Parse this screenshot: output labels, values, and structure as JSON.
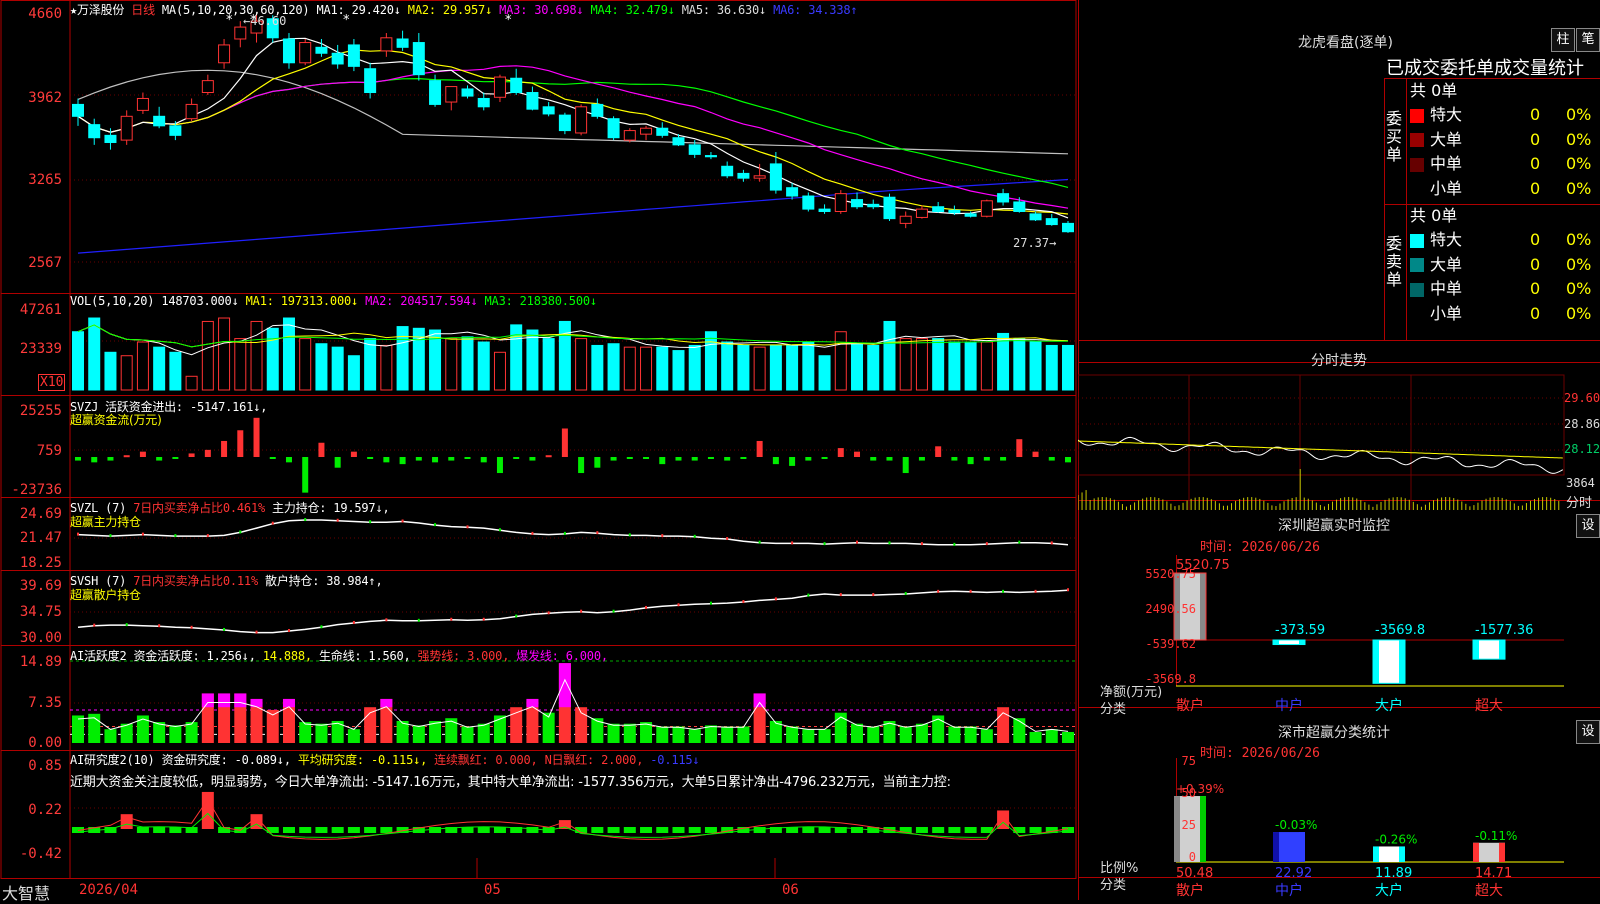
{
  "colors": {
    "up": "#ff3333",
    "down": "#00ffff",
    "ma5": "#ffffff",
    "ma10": "#ffff00",
    "ma20": "#ff00ff",
    "ma30": "#00ff00",
    "ma60": "#c0c0c0",
    "ma120": "#2020ff",
    "grid": "#b00000",
    "buyRed": "#ff2020"
  },
  "stock": {
    "name": "★万泽股份",
    "period": "日线",
    "ma_label": "MA(5,10,20,30,60,120)",
    "ma1": "MA1: 29.420↓",
    "ma2": "MA2: 29.957↓",
    "ma3": "MA3: 30.698↓",
    "ma4": "MA4: 32.479↓",
    "ma5": "MA5: 36.630↓",
    "ma6": "MA6: 34.338↑",
    "high_mark": "46.60",
    "low_mark": "27.37"
  },
  "price_axis": {
    "t1": "4660",
    "t2": "3962",
    "t3": "3265",
    "t4": "2567"
  },
  "vol": {
    "label": "VOL(5,10,20)",
    "v": "148703.000↓",
    "ma1": "MA1: 197313.000↓",
    "ma2": "MA2: 204517.594↓",
    "ma3": "MA3: 218380.500↓",
    "t1": "47261",
    "t2": "23339",
    "x10": "X10"
  },
  "svzj": {
    "label": "SVZJ  活跃资金进出: -5147.161↓,",
    "sub": "超赢资金流(万元)",
    "t1": "25255",
    "t2": "759",
    "t3": "-23736"
  },
  "svzl": {
    "label": "SVZL (7)",
    "red": "7日内买卖净占比0.461%",
    "val": "主力持仓: 19.597↓,",
    "sub": "超赢主力持仓",
    "t1": "24.69",
    "t2": "21.47",
    "t3": "18.25"
  },
  "svsh": {
    "label": "SVSH (7)",
    "red": "7日内买卖净占比0.11%",
    "val": "散户持仓: 38.984↑,",
    "sub": "超赢散户持仓",
    "t1": "39.69",
    "t2": "34.75",
    "t3": "30.00"
  },
  "ai2": {
    "label": "AI活跃度2 资金活跃度: 1.256↓,",
    "yellow": "14.888,",
    "life": "生命线: 1.560,",
    "strong": "强势线: 3.000,",
    "burst": "爆发线: 6.000,",
    "t1": "14.89",
    "t2": "7.35",
    "t3": "0.00"
  },
  "ai_research": {
    "label": "AI研究度2(10) 资金研究度: -0.089↓,",
    "avg": "平均研究度: -0.115↓,",
    "red": "连续飘红: 0.000,",
    "n": "N日飘红: 2.000,",
    "last": "-0.115↓",
    "comment": "近期大资金关注度较低，明显弱势，今日大单净流出: -5147.16万元，其中特大单净流出: -1577.356万元，大单5日累计净出-4796.232万元，当前主力控:",
    "t1": "0.85",
    "t2": "0.22",
    "t3": "-0.42"
  },
  "date_axis": {
    "start": "2026/04",
    "m5": "05",
    "m6": "06",
    "brand": "大智慧"
  },
  "lhb": {
    "title": "龙虎看盘(逐单)",
    "btn1": "柱",
    "btn2": "笔",
    "heading": "已成交委托单成交量统计",
    "buy_side": "委买单",
    "sell_side": "委卖单",
    "buy_total": "共 0单",
    "sell_total": "共 0单",
    "rows": [
      {
        "name": "特大",
        "v": "0",
        "p": "0%"
      },
      {
        "name": "大单",
        "v": "0",
        "p": "0%"
      },
      {
        "name": "中单",
        "v": "0",
        "p": "0%"
      },
      {
        "name": "小单",
        "v": "0",
        "p": "0%"
      }
    ]
  },
  "minute": {
    "title": "分时走势",
    "t1": "29.60",
    "t2": "28.86",
    "t3": "28.12",
    "t4": "3864",
    "t5": "分时"
  },
  "sz_monitor": {
    "title": "深圳超赢实时监控",
    "btn": "设",
    "time": "时间: 2026/06/26",
    "ylabel": "净额(万元)",
    "xlabel": "分类",
    "t1": "5520.75",
    "t2": "2490.56",
    "t3": "-539.62",
    "t4": "-3569.8",
    "categories": [
      "散户",
      "中户",
      "大户",
      "超大"
    ],
    "values": [
      5520.75,
      -373.59,
      -3569.8,
      -1577.36
    ],
    "labels": [
      "5520.75",
      "-373.59",
      "-3569.8",
      "-1577.36"
    ]
  },
  "sz_class": {
    "title": "深市超赢分类统计",
    "btn": "设",
    "time": "时间: 2026/06/26",
    "ylabel": "比例%",
    "xlabel": "分类",
    "t1": "75",
    "t2": "50",
    "t3": "25",
    "t4": "0",
    "categories": [
      "散户",
      "中户",
      "大户",
      "超大"
    ],
    "values": [
      50.48,
      22.92,
      11.89,
      14.71
    ],
    "labels": [
      "50.48",
      "22.92",
      "11.89",
      "14.71"
    ],
    "changes": [
      "+0.39%",
      "-0.03%",
      "-0.26%",
      "-0.11%"
    ]
  },
  "chart_data": [
    {
      "type": "candlestick",
      "title": "万泽股份 日线",
      "ylim": [
        2400,
        4700
      ],
      "high": "46.60",
      "low": "27.37",
      "ohlc": [
        [
          3900,
          3950,
          3720,
          3800
        ],
        [
          3730,
          3780,
          3560,
          3620
        ],
        [
          3640,
          3700,
          3520,
          3580
        ],
        [
          3600,
          3850,
          3560,
          3800
        ],
        [
          3850,
          4000,
          3820,
          3950
        ],
        [
          3800,
          3880,
          3700,
          3720
        ],
        [
          3720,
          3760,
          3600,
          3640
        ],
        [
          3780,
          3950,
          3760,
          3900
        ],
        [
          4000,
          4150,
          3980,
          4100
        ],
        [
          4250,
          4450,
          4200,
          4400
        ],
        [
          4450,
          4600,
          4380,
          4550
        ],
        [
          4500,
          4660,
          4420,
          4600
        ],
        [
          4620,
          4650,
          4420,
          4460
        ],
        [
          4450,
          4500,
          4200,
          4250
        ],
        [
          4250,
          4450,
          4230,
          4420
        ],
        [
          4380,
          4450,
          4300,
          4330
        ],
        [
          4330,
          4400,
          4200,
          4240
        ],
        [
          4400,
          4450,
          4180,
          4220
        ],
        [
          4200,
          4250,
          3950,
          4000
        ],
        [
          4350,
          4500,
          4300,
          4460
        ],
        [
          4450,
          4520,
          4350,
          4380
        ],
        [
          4420,
          4500,
          4100,
          4150
        ],
        [
          4100,
          4150,
          3880,
          3900
        ],
        [
          3920,
          4050,
          3850,
          4050
        ],
        [
          4030,
          4060,
          3950,
          3970
        ],
        [
          3950,
          4000,
          3850,
          3880
        ],
        [
          3960,
          4150,
          3920,
          4130
        ],
        [
          4120,
          4200,
          3980,
          4000
        ],
        [
          4000,
          4050,
          3850,
          3860
        ],
        [
          3880,
          3920,
          3800,
          3820
        ],
        [
          3810,
          3830,
          3650,
          3680
        ],
        [
          3660,
          3900,
          3640,
          3880
        ],
        [
          3900,
          3950,
          3780,
          3800
        ],
        [
          3780,
          3800,
          3600,
          3620
        ],
        [
          3600,
          3700,
          3580,
          3680
        ],
        [
          3650,
          3720,
          3600,
          3700
        ],
        [
          3700,
          3750,
          3620,
          3640
        ],
        [
          3620,
          3650,
          3550,
          3560
        ],
        [
          3560,
          3600,
          3450,
          3480
        ],
        [
          3470,
          3500,
          3440,
          3460
        ],
        [
          3380,
          3420,
          3280,
          3300
        ],
        [
          3320,
          3350,
          3250,
          3280
        ],
        [
          3280,
          3400,
          3250,
          3300
        ],
        [
          3400,
          3500,
          3150,
          3180
        ],
        [
          3200,
          3240,
          3100,
          3130
        ],
        [
          3130,
          3160,
          3000,
          3020
        ],
        [
          3020,
          3060,
          2980,
          3000
        ],
        [
          3000,
          3180,
          2980,
          3150
        ],
        [
          3100,
          3160,
          3020,
          3040
        ],
        [
          3060,
          3100,
          3020,
          3040
        ],
        [
          3120,
          3150,
          2920,
          2940
        ],
        [
          2900,
          3000,
          2860,
          2960
        ],
        [
          2950,
          3050,
          2940,
          3020
        ],
        [
          3040,
          3080,
          2990,
          3000
        ],
        [
          3010,
          3050,
          2970,
          2990
        ],
        [
          2980,
          3000,
          2950,
          2960
        ],
        [
          2960,
          3100,
          2950,
          3090
        ],
        [
          3150,
          3190,
          3050,
          3080
        ],
        [
          3080,
          3120,
          2990,
          3000
        ],
        [
          2980,
          3000,
          2920,
          2930
        ],
        [
          2940,
          2980,
          2880,
          2890
        ],
        [
          2900,
          2920,
          2820,
          2830
        ]
      ]
    },
    {
      "type": "bar",
      "title": "VOL(5,10,20)",
      "values": [
        34000,
        42000,
        22000,
        20000,
        28000,
        25000,
        22000,
        8000,
        40000,
        42000,
        30000,
        40000,
        36000,
        42000,
        30000,
        27000,
        25000,
        20000,
        30000,
        26000,
        37000,
        36000,
        35000,
        30000,
        31000,
        28000,
        22000,
        38000,
        35000,
        30000,
        40000,
        30000,
        26000,
        27000,
        25000,
        25000,
        25000,
        23000,
        26000,
        34000,
        28000,
        26000,
        25000,
        26000,
        26000,
        28000,
        20000,
        34000,
        27000,
        26000,
        40000,
        30000,
        30000,
        30000,
        28000,
        28000,
        28000,
        33000,
        30000,
        28000,
        26000,
        26000
      ]
    },
    {
      "type": "bar",
      "title": "SVZJ 活跃资金进出",
      "values": [
        -2000,
        -3000,
        -2000,
        1000,
        3000,
        -2000,
        -1000,
        2000,
        4000,
        9000,
        15000,
        22000,
        -1000,
        -3000,
        -20000,
        8000,
        -6000,
        3000,
        -1000,
        -3000,
        -4000,
        -2000,
        -3000,
        -2000,
        -1000,
        -3000,
        -9000,
        -1000,
        -2000,
        1000,
        16000,
        -9000,
        -6000,
        -2000,
        -1000,
        -1000,
        -4000,
        -2000,
        -2000,
        -1000,
        -2000,
        -1000,
        9000,
        -4000,
        -5000,
        -2000,
        -1000,
        5000,
        3000,
        -2000,
        -2000,
        -9000,
        -2000,
        6000,
        -2000,
        -4000,
        -2000,
        -2000,
        10000,
        3000,
        -2000,
        -3000
      ]
    },
    {
      "type": "line",
      "title": "超赢主力持仓",
      "ylim": [
        18.25,
        24.69
      ],
      "values": [
        22.0,
        21.9,
        21.8,
        21.9,
        22.0,
        21.9,
        21.8,
        21.8,
        21.8,
        21.9,
        22.3,
        22.9,
        23.5,
        23.9,
        24.0,
        24.0,
        23.9,
        23.8,
        23.7,
        23.7,
        23.8,
        23.6,
        23.3,
        23.1,
        23.0,
        22.9,
        22.6,
        22.3,
        22.1,
        22.0,
        22.1,
        22.3,
        22.2,
        22.0,
        21.9,
        21.9,
        21.8,
        21.8,
        21.7,
        21.5,
        21.4,
        21.1,
        20.9,
        20.8,
        20.8,
        20.8,
        20.7,
        20.8,
        20.9,
        20.8,
        20.8,
        20.8,
        20.7,
        20.6,
        20.6,
        20.6,
        20.7,
        20.8,
        20.9,
        20.9,
        20.8,
        20.6
      ]
    },
    {
      "type": "line",
      "title": "超赢散户持仓",
      "ylim": [
        30.0,
        39.69
      ],
      "values": [
        32.0,
        32.3,
        32.4,
        32.4,
        32.3,
        32.2,
        32.0,
        31.9,
        31.7,
        31.5,
        31.2,
        31.0,
        31.0,
        31.3,
        31.6,
        32.0,
        32.5,
        32.8,
        33.1,
        33.3,
        33.2,
        33.2,
        33.3,
        33.4,
        33.3,
        33.4,
        33.6,
        34.0,
        34.4,
        34.6,
        34.8,
        34.9,
        34.7,
        34.9,
        35.2,
        35.6,
        35.9,
        36.1,
        36.3,
        36.4,
        36.5,
        36.7,
        37.0,
        37.2,
        37.4,
        37.9,
        38.2,
        38.0,
        38.0,
        38.0,
        38.1,
        38.2,
        38.4,
        38.6,
        38.7,
        38.6,
        38.5,
        38.6,
        38.5,
        38.6,
        38.7,
        38.9
      ]
    },
    {
      "type": "bar",
      "title": "AI活跃度2",
      "ylim": [
        0,
        14.89
      ],
      "values": [
        5.0,
        5.3,
        2.5,
        3.5,
        5.0,
        3.8,
        3.2,
        3.8,
        9.0,
        9.0,
        9.0,
        8.0,
        6.0,
        8.0,
        3.8,
        3.5,
        4.0,
        2.5,
        6.5,
        8.0,
        4.0,
        3.2,
        4.0,
        4.5,
        3.0,
        3.5,
        5.0,
        6.5,
        8.0,
        5.5,
        14.5,
        6.5,
        4.5,
        3.5,
        3.5,
        3.8,
        3.0,
        3.0,
        2.5,
        3.2,
        3.0,
        3.0,
        9.0,
        4.0,
        3.0,
        2.5,
        2.5,
        5.5,
        3.5,
        3.0,
        4.0,
        3.0,
        3.5,
        5.0,
        3.0,
        3.0,
        2.5,
        6.5,
        4.5,
        2.0,
        2.5,
        2.0
      ]
    },
    {
      "type": "bar",
      "title": "AI研究度2(10)",
      "ylim": [
        -0.42,
        0.85
      ],
      "values": [
        0.0,
        -0.05,
        0.0,
        0.2,
        -0.05,
        -0.05,
        0.0,
        -0.05,
        0.5,
        0.0,
        0.0,
        0.2,
        0.0,
        0.0,
        0.0,
        0.0,
        0.0,
        0.0,
        0.0,
        0.0,
        0.0,
        0.0,
        0.0,
        0.0,
        0.03,
        0.0,
        0.0,
        0.0,
        0.0,
        0.0,
        0.12,
        0.0,
        0.0,
        0.0,
        0.0,
        0.0,
        0.0,
        0.0,
        0.0,
        0.0,
        0.0,
        0.0,
        0.03,
        0.0,
        0.0,
        0.0,
        0.0,
        0.0,
        0.0,
        0.0,
        0.0,
        0.0,
        0.0,
        0.0,
        0.0,
        0.0,
        0.0,
        0.25,
        0.0,
        0.0,
        0.0,
        0.0
      ]
    }
  ]
}
